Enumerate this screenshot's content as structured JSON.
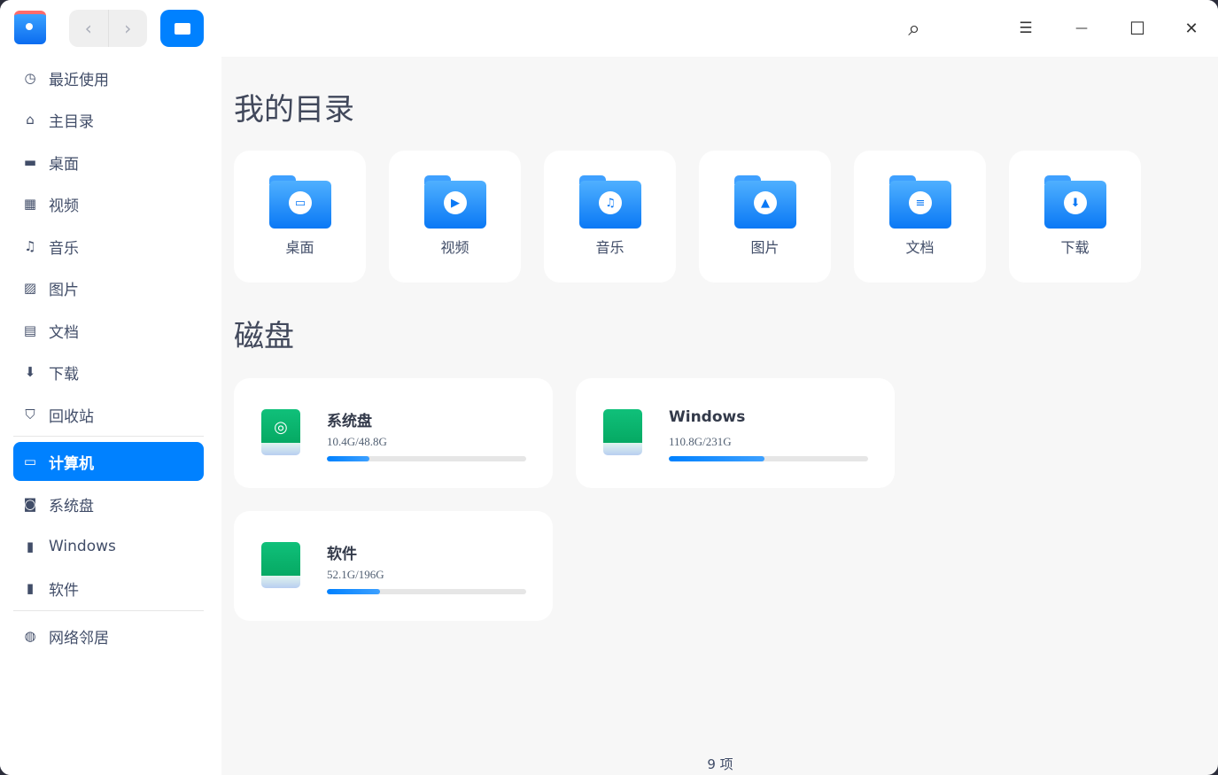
{
  "toolbar": {
    "back": "‹",
    "forward": "›",
    "search": "⌕",
    "menu": "☰",
    "minimize": "—",
    "maximize": "☐",
    "close": "✕"
  },
  "sidebar": {
    "items": [
      {
        "label": "最近使用",
        "icon": "clock-icon",
        "glyph": "◷"
      },
      {
        "label": "主目录",
        "icon": "home-icon",
        "glyph": "⌂"
      },
      {
        "label": "桌面",
        "icon": "desktop-icon",
        "glyph": "▬"
      },
      {
        "label": "视频",
        "icon": "video-icon",
        "glyph": "▦"
      },
      {
        "label": "音乐",
        "icon": "music-icon",
        "glyph": "♫"
      },
      {
        "label": "图片",
        "icon": "picture-icon",
        "glyph": "▨"
      },
      {
        "label": "文档",
        "icon": "document-icon",
        "glyph": "▤"
      },
      {
        "label": "下载",
        "icon": "download-icon",
        "glyph": "⬇"
      },
      {
        "label": "回收站",
        "icon": "trash-icon",
        "glyph": "⛉"
      },
      {
        "label": "计算机",
        "icon": "computer-icon",
        "glyph": "▭"
      },
      {
        "label": "系统盘",
        "icon": "disk-icon",
        "glyph": "◙"
      },
      {
        "label": "Windows",
        "icon": "disk-icon",
        "glyph": "▮"
      },
      {
        "label": "软件",
        "icon": "disk-icon",
        "glyph": "▮"
      },
      {
        "label": "网络邻居",
        "icon": "network-icon",
        "glyph": "◍"
      }
    ]
  },
  "main": {
    "dirs_title": "我的目录",
    "dirs": [
      {
        "label": "桌面",
        "glyph": "▭"
      },
      {
        "label": "视频",
        "glyph": "▶"
      },
      {
        "label": "音乐",
        "glyph": "♫"
      },
      {
        "label": "图片",
        "glyph": "▲"
      },
      {
        "label": "文档",
        "glyph": "≡"
      },
      {
        "label": "下载",
        "glyph": "⬇"
      }
    ],
    "disks_title": "磁盘",
    "disks": [
      {
        "name": "系统盘",
        "size": "10.4G/48.8G",
        "used_fraction": 0.213,
        "glyph": "◎"
      },
      {
        "name": "Windows",
        "size": "110.8G/231G",
        "used_fraction": 0.48,
        "glyph": ""
      },
      {
        "name": "软件",
        "size": "52.1G/196G",
        "used_fraction": 0.266,
        "glyph": ""
      }
    ]
  },
  "status": {
    "count": "9 项"
  },
  "colors": {
    "accent": "#0081ff",
    "drive": "#05a862"
  }
}
